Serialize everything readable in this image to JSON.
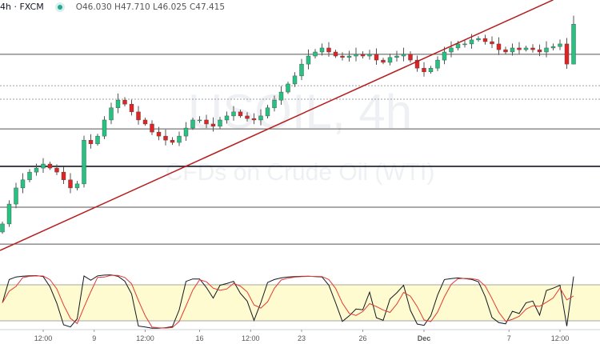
{
  "header": {
    "interval_exchange": "4h · FXCM",
    "ohlc": "O46.030 H47.710 L46.025 C47.415",
    "status_color": "#26a69a"
  },
  "watermark": {
    "symbol": "USOIL, 4h",
    "description": "CFDs on Crude Oil (WTI)"
  },
  "chart_data": {
    "type": "candlestick",
    "price_range": [
      39.2,
      48.3
    ],
    "closes": [
      40.48,
      41.17,
      41.73,
      42.01,
      42.28,
      42.42,
      42.56,
      42.42,
      42.28,
      42.01,
      41.73,
      41.87,
      43.39,
      43.26,
      43.53,
      44.09,
      44.51,
      44.78,
      44.64,
      44.37,
      44.09,
      43.95,
      43.67,
      43.53,
      43.39,
      43.31,
      43.53,
      43.81,
      44.09,
      44.09,
      43.95,
      43.87,
      44.09,
      44.23,
      44.37,
      44.23,
      44.14,
      44.09,
      44.23,
      44.51,
      44.78,
      45.06,
      45.34,
      45.62,
      46.03,
      46.31,
      46.45,
      46.59,
      46.45,
      46.31,
      46.26,
      46.31,
      46.37,
      46.31,
      46.37,
      46.17,
      46.09,
      46.26,
      46.31,
      46.37,
      46.17,
      45.89,
      45.76,
      45.89,
      46.17,
      46.45,
      46.59,
      46.73,
      46.73,
      46.87,
      46.92,
      46.81,
      46.73,
      46.53,
      46.45,
      46.59,
      46.53,
      46.59,
      46.53,
      46.45,
      46.59,
      46.64,
      46.73,
      46.03,
      47.415
    ],
    "first_open": 40.2,
    "last_bar": {
      "open": 46.03,
      "high": 47.71,
      "low": 46.025,
      "close": 47.415
    },
    "horizontal_levels": [
      {
        "price": 46.37,
        "style": "solid"
      },
      {
        "price": 45.28,
        "style": "dotted"
      },
      {
        "price": 44.81,
        "style": "dotted"
      },
      {
        "price": 43.78,
        "style": "solid"
      },
      {
        "price": 42.48,
        "style": "solid-thick"
      },
      {
        "price": 41.06,
        "style": "solid"
      },
      {
        "price": 39.78,
        "style": "solid"
      }
    ],
    "trendline": {
      "start": {
        "bar": 0,
        "price": 39.56
      },
      "end": {
        "bar": 81,
        "price": 48.26
      },
      "color": "#b71c1c"
    },
    "x_ticks": [
      {
        "bar": 6,
        "label": "12:00"
      },
      {
        "bar": 13.5,
        "label": "9"
      },
      {
        "bar": 21,
        "label": "12:00"
      },
      {
        "bar": 29,
        "label": "16"
      },
      {
        "bar": 36.5,
        "label": "12:00"
      },
      {
        "bar": 44,
        "label": "23"
      },
      {
        "bar": 53,
        "label": "26"
      },
      {
        "bar": 62,
        "label": "Dec",
        "bold": true
      },
      {
        "bar": 74.5,
        "label": "7"
      },
      {
        "bar": 82,
        "label": "12:00"
      }
    ],
    "indicator": {
      "type": "stochastic",
      "period": 14,
      "band": [
        20,
        80
      ],
      "k_color": "#131722",
      "d_color": "#e53935",
      "band_color": "#fffbd0"
    },
    "colors": {
      "up": "#26c281",
      "down": "#e02424"
    }
  }
}
